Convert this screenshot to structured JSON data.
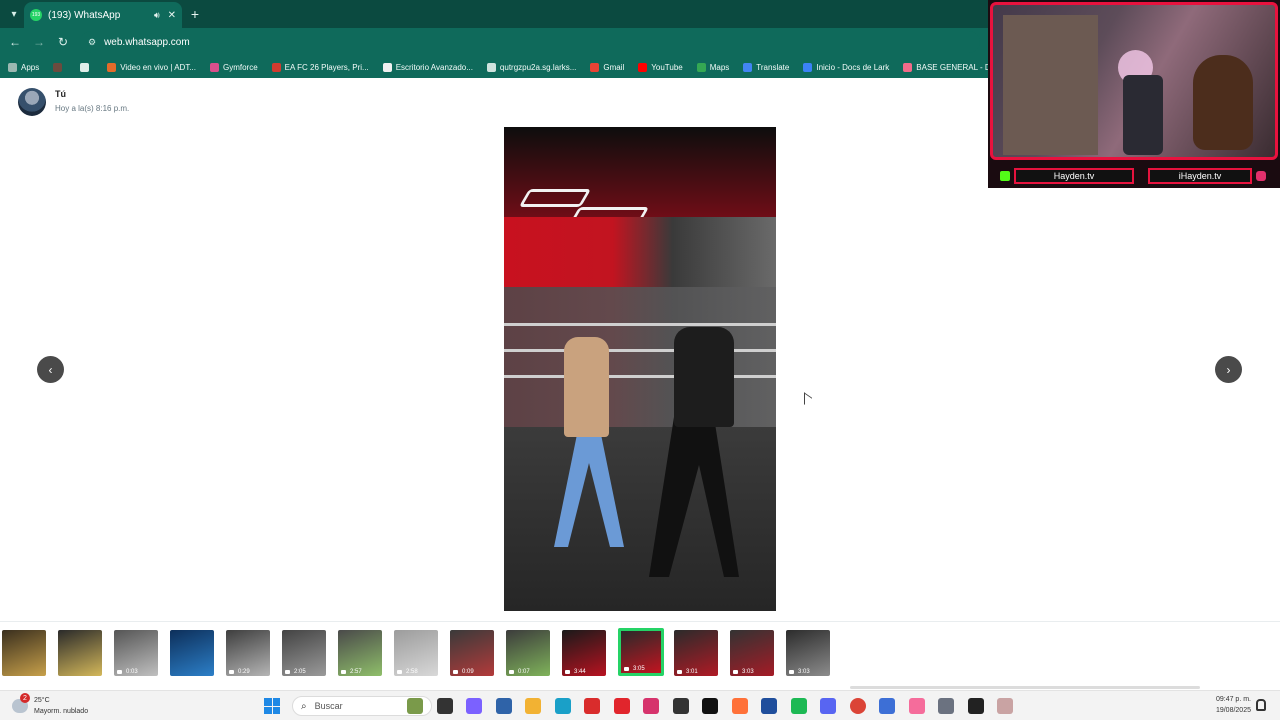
{
  "browser": {
    "tab_title": "(193) WhatsApp",
    "tab_favicon_label": "193",
    "url": "web.whatsapp.com",
    "bookmarks": [
      {
        "label": "Apps",
        "icon": "apps-grid-icon",
        "color": "#9bb8b1"
      },
      {
        "label": "",
        "icon": "avatar-icon",
        "color": "#6b4b3e"
      },
      {
        "label": "",
        "icon": "tab-groups-icon",
        "color": "#dfeee9"
      },
      {
        "label": "Video en vivo | ADT...",
        "icon": "tiktok-icon",
        "color": "#e36b2a"
      },
      {
        "label": "Gymforce",
        "icon": "gymforce-icon",
        "color": "#d94f8c"
      },
      {
        "label": "EA FC 26 Players, Pri...",
        "icon": "ea-icon",
        "color": "#d13b2f"
      },
      {
        "label": "Escritorio Avanzado...",
        "icon": "escritorio-icon",
        "color": "#f0f0f0"
      },
      {
        "label": "qutrgzpu2a.sg.larks...",
        "icon": "globe-icon",
        "color": "#cfe3de"
      },
      {
        "label": "Gmail",
        "icon": "gmail-icon",
        "color": "#ea4335"
      },
      {
        "label": "YouTube",
        "icon": "youtube-icon",
        "color": "#ff0000"
      },
      {
        "label": "Maps",
        "icon": "maps-icon",
        "color": "#34a853"
      },
      {
        "label": "Translate",
        "icon": "translate-icon",
        "color": "#4285f4"
      },
      {
        "label": "Inicio - Docs de Lark",
        "icon": "lark-icon",
        "color": "#3b82f6"
      },
      {
        "label": "BASE GENERAL - Do...",
        "icon": "base-icon",
        "color": "#f26b8a"
      },
      {
        "label": "",
        "icon": "globe-icon",
        "color": "#cfe3de"
      }
    ]
  },
  "webcam": {
    "left_handle": "Hayden.tv",
    "right_handle": "iHayden.tv"
  },
  "viewer": {
    "sender_name": "Tú",
    "sender_time": "Hoy a la(s) 8:16 p.m.",
    "prev_label": "‹",
    "next_label": "›"
  },
  "thumbnails": [
    {
      "duration": "",
      "colors": [
        "#3a2f1e",
        "#c7a04a"
      ]
    },
    {
      "duration": "",
      "colors": [
        "#2a2a2a",
        "#d4b85a"
      ]
    },
    {
      "duration": "0:03",
      "colors": [
        "#555",
        "#c0c0c0"
      ]
    },
    {
      "duration": "",
      "colors": [
        "#0d2f5a",
        "#2c7fc8"
      ]
    },
    {
      "duration": "0:29",
      "colors": [
        "#3e3e3e",
        "#b5b5b5"
      ]
    },
    {
      "duration": "2:05",
      "colors": [
        "#434343",
        "#9a9a9a"
      ]
    },
    {
      "duration": "2:57",
      "colors": [
        "#4a4a4a",
        "#8fbf6a"
      ]
    },
    {
      "duration": "2:58",
      "colors": [
        "#9c9c9c",
        "#d8d8d8"
      ]
    },
    {
      "duration": "0:09",
      "colors": [
        "#3a3a3a",
        "#b33a3a"
      ]
    },
    {
      "duration": "0:07",
      "colors": [
        "#3c3c3c",
        "#7fb35a"
      ]
    },
    {
      "duration": "3:44",
      "colors": [
        "#1a1a1a",
        "#b81220"
      ]
    },
    {
      "duration": "3:05",
      "colors": [
        "#2a2a2a",
        "#c21420"
      ],
      "active": true
    },
    {
      "duration": "3:01",
      "colors": [
        "#2b2b2b",
        "#b01a25"
      ]
    },
    {
      "duration": "3:03",
      "colors": [
        "#333",
        "#a51b26"
      ]
    },
    {
      "duration": "3:03",
      "colors": [
        "#2c2c2c",
        "#8c8c8c"
      ]
    }
  ],
  "taskbar": {
    "weather_temp": "25°C",
    "weather_desc": "Mayorm. nublado",
    "weather_badge": "2",
    "search_placeholder": "Buscar",
    "clock_time": "09:47 p. m.",
    "clock_date": "19/08/2025",
    "apps": [
      {
        "name": "trees-widget-icon",
        "color": "#7a9a4a"
      },
      {
        "name": "task-view-icon",
        "color": "#333"
      },
      {
        "name": "copilot-icon",
        "color": "#7b61ff"
      },
      {
        "name": "teams-icon",
        "color": "#2f63a8"
      },
      {
        "name": "file-explorer-icon",
        "color": "#f2b233"
      },
      {
        "name": "edge-icon",
        "color": "#1aa0c8"
      },
      {
        "name": "acrobat-icon",
        "color": "#d92c2c"
      },
      {
        "name": "opera-icon",
        "color": "#e1252c"
      },
      {
        "name": "app-a-icon",
        "color": "#d6336c"
      },
      {
        "name": "app-dark-icon",
        "color": "#333"
      },
      {
        "name": "github-icon",
        "color": "#111"
      },
      {
        "name": "firefox-icon",
        "color": "#ff7139"
      },
      {
        "name": "app-blue-icon",
        "color": "#1f4e9c"
      },
      {
        "name": "spotify-icon",
        "color": "#1db954"
      },
      {
        "name": "discord-icon",
        "color": "#5865f2"
      },
      {
        "name": "chrome-icon",
        "color": "#db4437"
      },
      {
        "name": "app-arc-icon",
        "color": "#3d6fd6"
      },
      {
        "name": "itunes-icon",
        "color": "#f56c9b"
      },
      {
        "name": "settings-icon",
        "color": "#6b7280"
      },
      {
        "name": "media-player-icon",
        "color": "#222"
      },
      {
        "name": "app-gray-icon",
        "color": "#c9a3a3"
      }
    ]
  },
  "colors": {
    "chrome_dark": "#0b4a40",
    "chrome": "#0f6a5b",
    "accent": "#25d366",
    "stream_red": "#e8123e"
  }
}
